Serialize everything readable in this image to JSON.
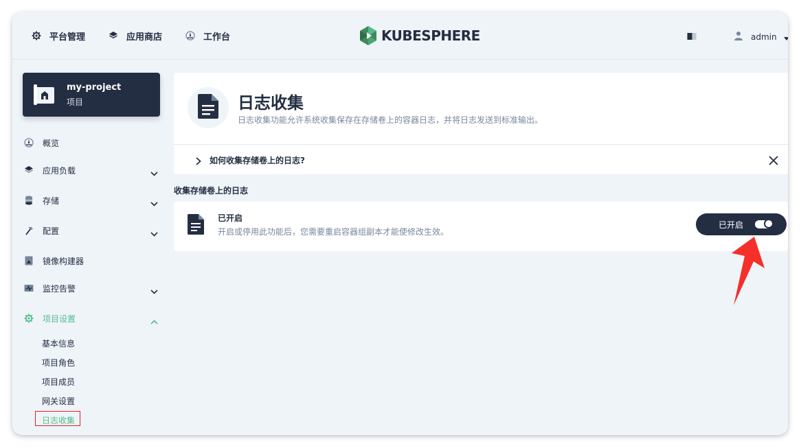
{
  "header": {
    "nav": [
      {
        "label": "平台管理",
        "icon": "gear-icon"
      },
      {
        "label": "应用商店",
        "icon": "layers-icon"
      },
      {
        "label": "工作台",
        "icon": "dashboard-icon"
      }
    ],
    "logo_text": "KUBESPHERE",
    "user_name": "admin"
  },
  "project": {
    "name": "my-project",
    "type": "项目"
  },
  "sidebar": {
    "items": [
      {
        "label": "概览",
        "icon": "overview-icon"
      },
      {
        "label": "应用负载",
        "icon": "layers-icon"
      },
      {
        "label": "存储",
        "icon": "storage-icon"
      },
      {
        "label": "配置",
        "icon": "hammer-icon"
      },
      {
        "label": "镜像构建器",
        "icon": "image-builder-icon"
      },
      {
        "label": "监控告警",
        "icon": "monitor-icon"
      },
      {
        "label": "项目设置",
        "icon": "gear-icon"
      }
    ],
    "settings_sub": [
      "基本信息",
      "项目角色",
      "项目成员",
      "网关设置",
      "日志收集"
    ],
    "active_sub": "日志收集"
  },
  "main": {
    "title": "日志收集",
    "description": "日志收集功能允许系统收集保存在存储卷上的容器日志，并将日志发送到标准输出。",
    "faq": "如何收集存储卷上的日志?",
    "section_title": "收集存储卷上的日志",
    "status_title": "已开启",
    "status_desc": "开启或停用此功能后，您需要重启容器组副本才能使修改生效。",
    "toggle_label": "已开启",
    "toggle_on": true
  },
  "colors": {
    "accent": "#55bc8a",
    "dark": "#242e42",
    "muted": "#79879c",
    "background": "#eff4f9",
    "highlight": "#e02020"
  }
}
